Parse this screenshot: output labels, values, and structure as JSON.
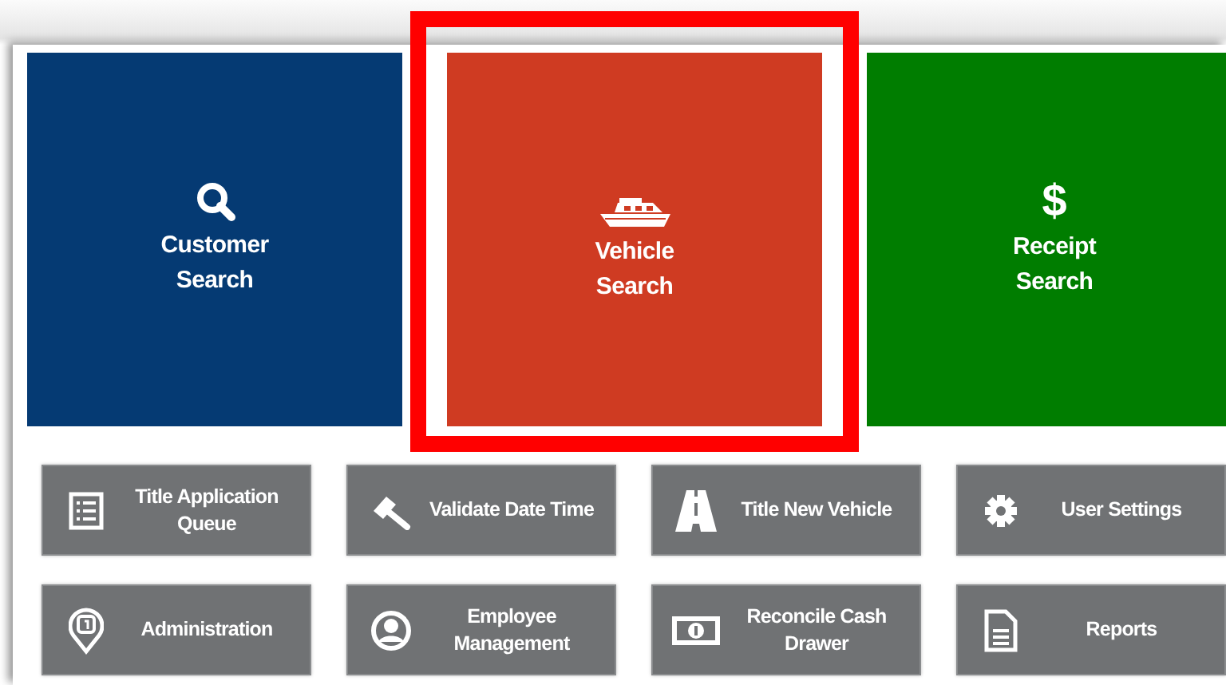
{
  "tiles": [
    {
      "label": "Customer\nSearch",
      "kind": "search",
      "color": "#053a73",
      "highlighted": false
    },
    {
      "label": "Vehicle\nSearch",
      "kind": "boat",
      "color": "#cf3b22",
      "highlighted": true
    },
    {
      "label": "Receipt\nSearch",
      "kind": "dollar",
      "icon_text": "$",
      "color": "#007d00",
      "highlighted": false
    }
  ],
  "buttons": [
    {
      "label": "Title Application\nQueue",
      "kind": "list"
    },
    {
      "label": "Validate Date Time",
      "kind": "gavel"
    },
    {
      "label": "Title New Vehicle",
      "kind": "road"
    },
    {
      "label": "User Settings",
      "kind": "gear"
    },
    {
      "label": "Administration",
      "kind": "badge"
    },
    {
      "label": "Employee\nManagement",
      "kind": "person"
    },
    {
      "label": "Reconcile Cash\nDrawer",
      "kind": "cash"
    },
    {
      "label": "Reports",
      "kind": "document"
    }
  ]
}
